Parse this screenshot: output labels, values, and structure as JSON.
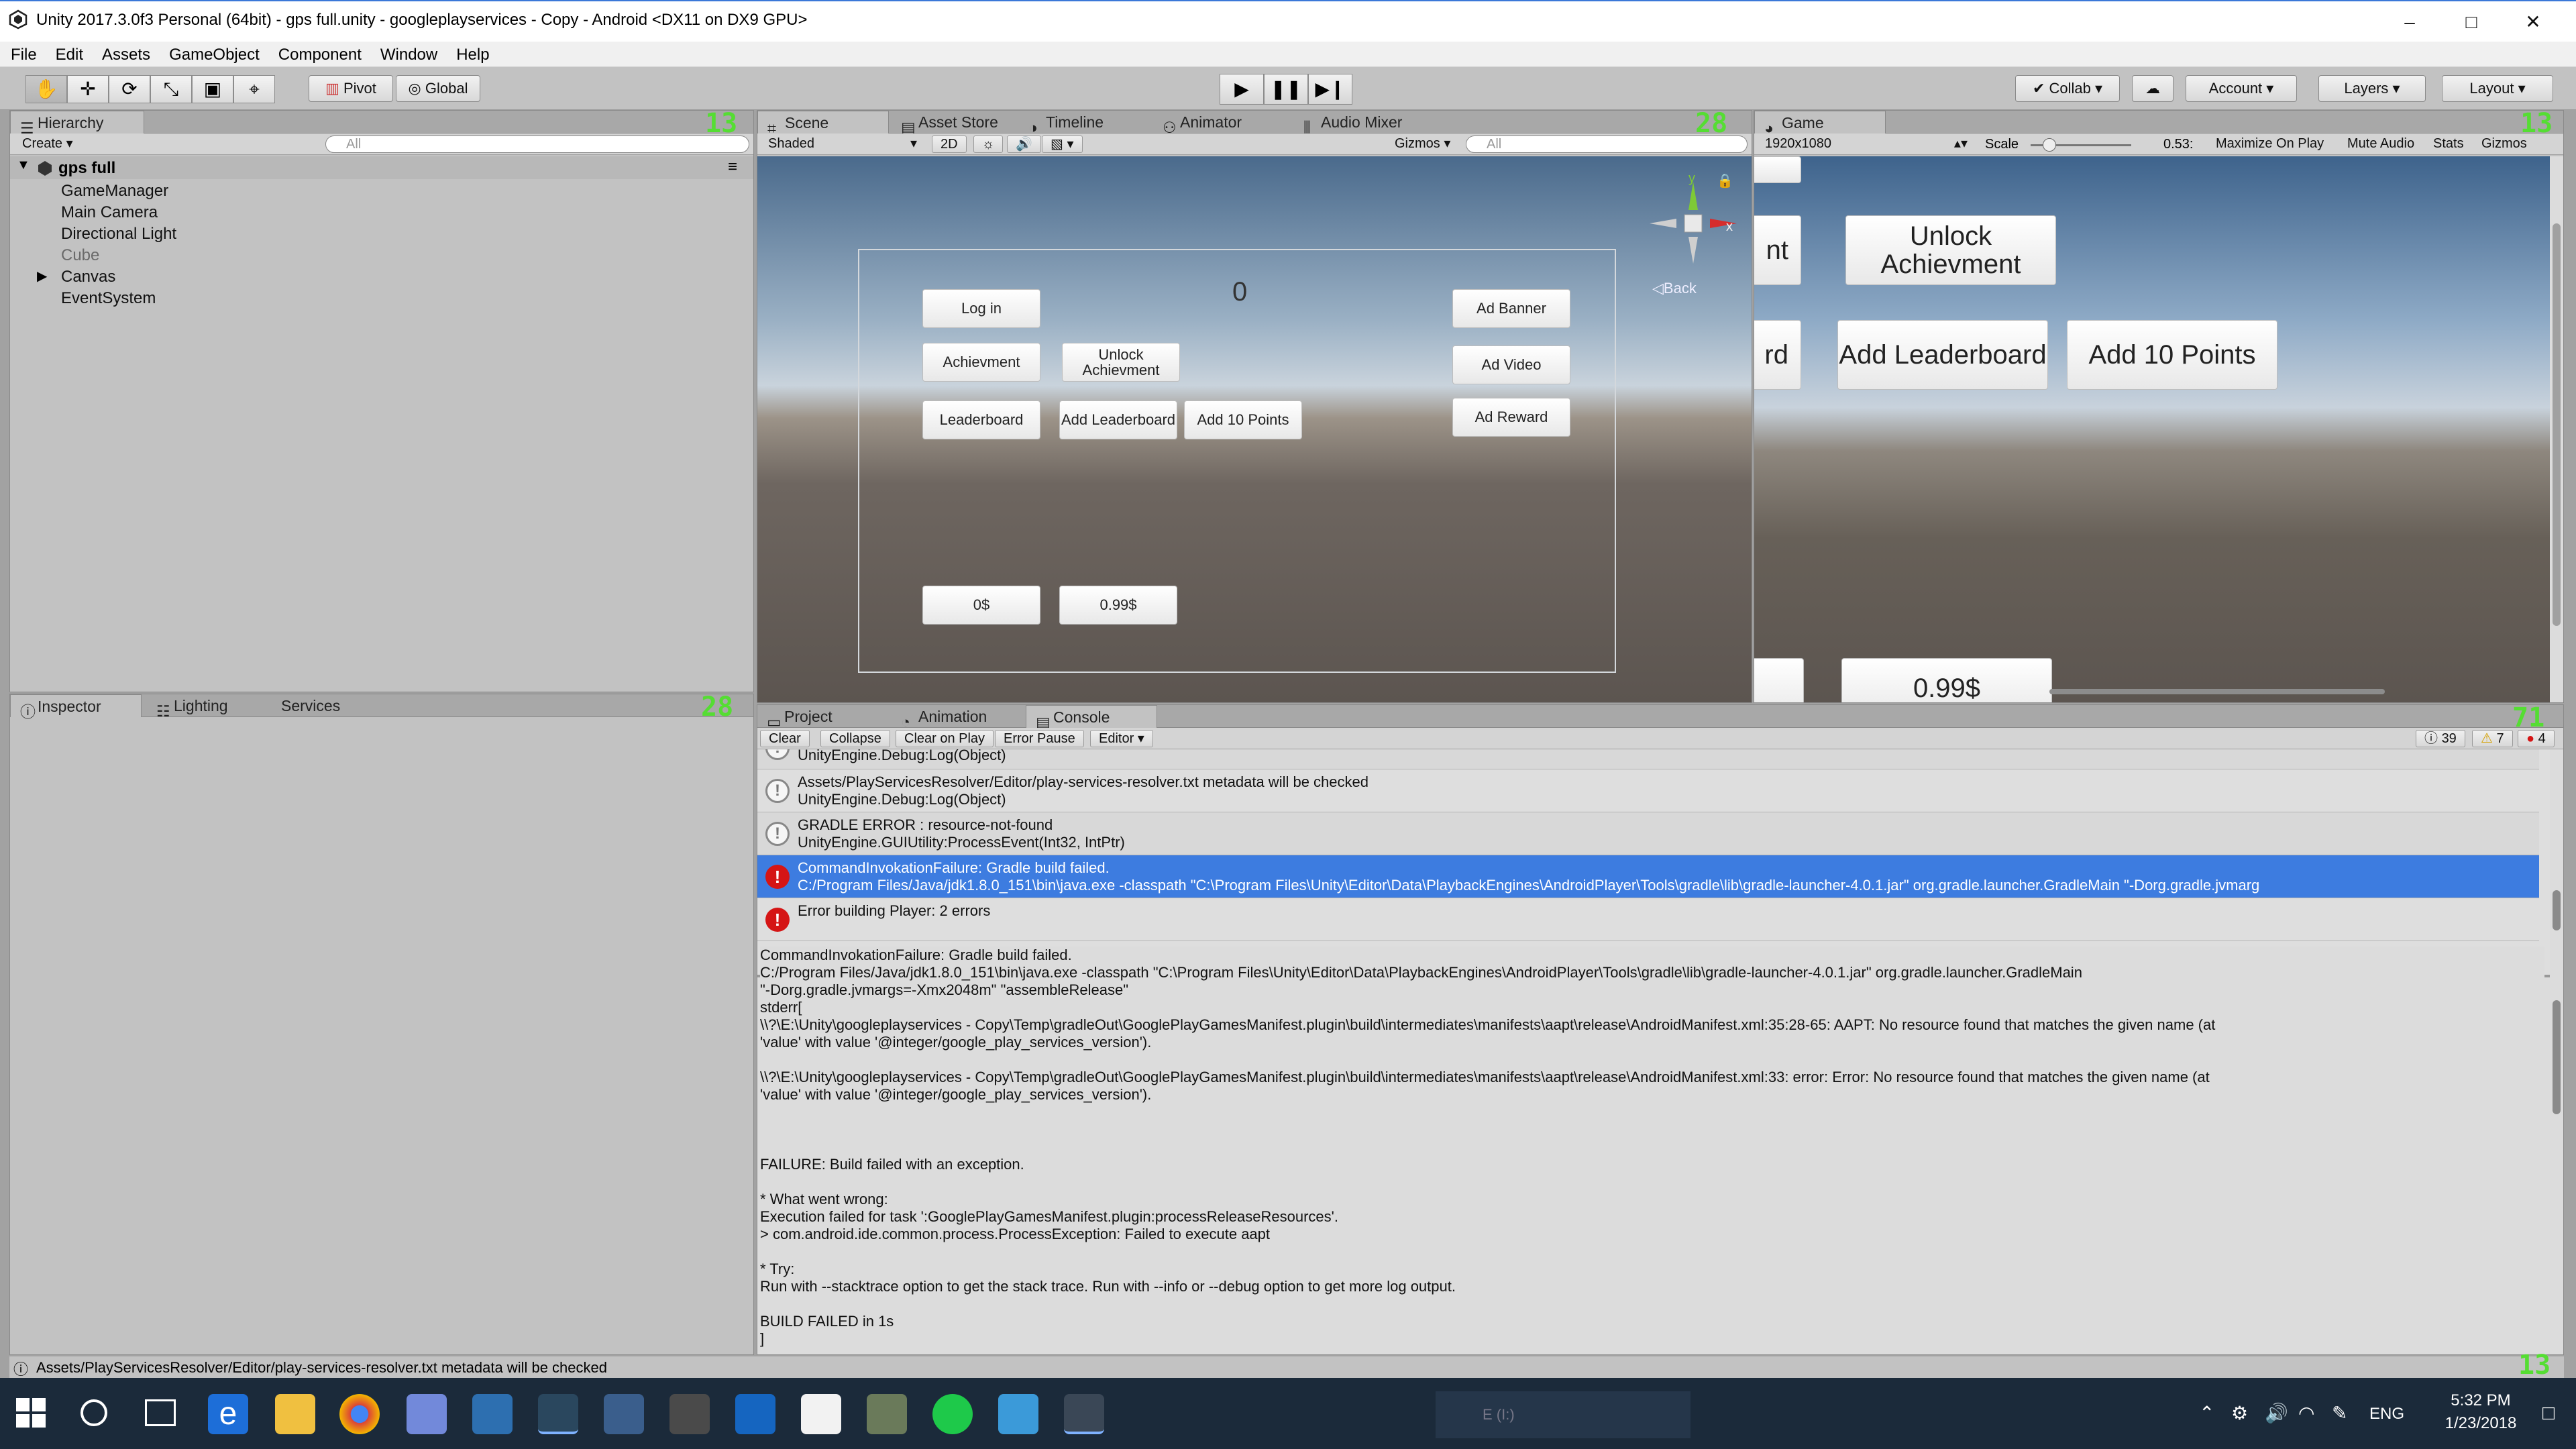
{
  "window": {
    "title": "Unity 2017.3.0f3 Personal (64bit) - gps full.unity - googleplayservices - Copy - Android <DX11 on DX9 GPU>"
  },
  "menu": [
    "File",
    "Edit",
    "Assets",
    "GameObject",
    "Component",
    "Window",
    "Help"
  ],
  "toolbar": {
    "pivot": "Pivot",
    "global": "Global",
    "collab": "Collab",
    "account": "Account",
    "layers": "Layers",
    "layout": "Layout"
  },
  "hierarchy": {
    "tab": "Hierarchy",
    "create": "Create",
    "search_placeholder": "All",
    "scene": "gps full",
    "items": [
      "GameManager",
      "Main Camera",
      "Directional Light",
      "Cube",
      "Canvas",
      "EventSystem"
    ],
    "corner_num": "13"
  },
  "scene": {
    "tabs": [
      "Scene",
      "Asset Store",
      "Timeline",
      "Animator",
      "Audio Mixer"
    ],
    "shading": "Shaded",
    "mode2d": "2D",
    "gizmos": "Gizmos",
    "search_placeholder": "All",
    "gizmo_back": "Back",
    "gizmo_y": "y",
    "gizmo_x": "x",
    "score": "0",
    "buttons": {
      "login": "Log in",
      "achievment": "Achievment",
      "unlock": "Unlock Achievment",
      "leaderboard": "Leaderboard",
      "add_leaderboard": "Add Leaderboard",
      "add10": "Add 10 Points",
      "ad_banner": "Ad Banner",
      "ad_video": "Ad Video",
      "ad_reward": "Ad Reward",
      "price0": "0$",
      "price099": "0.99$"
    },
    "corner_num": "28"
  },
  "game": {
    "tab": "Game",
    "resolution": "1920x1080",
    "scale_label": "Scale",
    "scale_value": "0.53:",
    "maximize": "Maximize On Play",
    "mute": "Mute Audio",
    "stats": "Stats",
    "gizmos": "Gizmos",
    "partial_left1": "nt",
    "partial_left2": "rd",
    "unlock": "Unlock Achievment",
    "add_leaderboard": "Add Leaderboard",
    "add10": "Add 10 Points",
    "price099": "0.99$",
    "corner_num": "13"
  },
  "inspector": {
    "tabs": [
      "Inspector",
      "Lighting",
      "Services"
    ],
    "corner_num": "28"
  },
  "console": {
    "tabs": [
      "Project",
      "Animation",
      "Console"
    ],
    "buttons": [
      "Clear",
      "Collapse",
      "Clear on Play",
      "Error Pause",
      "Editor"
    ],
    "counts": {
      "info": "39",
      "warn": "7",
      "err": "4"
    },
    "corner_num": "71",
    "rows": [
      {
        "type": "warn",
        "line1": "UnityEngine.Debug:Log(Object)",
        "line2": ""
      },
      {
        "type": "warn",
        "line1": "Assets/PlayServicesResolver/Editor/play-services-resolver.txt metadata will be checked",
        "line2": "UnityEngine.Debug:Log(Object)"
      },
      {
        "type": "warn",
        "line1": "GRADLE ERROR : resource-not-found",
        "line2": "UnityEngine.GUIUtility:ProcessEvent(Int32, IntPtr)"
      },
      {
        "type": "err",
        "line1": "CommandInvokationFailure: Gradle build failed.",
        "line2": "C:/Program Files/Java/jdk1.8.0_151\\bin\\java.exe -classpath \"C:\\Program Files\\Unity\\Editor\\Data\\PlaybackEngines\\AndroidPlayer\\Tools\\gradle\\lib\\gradle-launcher-4.0.1.jar\" org.gradle.launcher.GradleMain \"-Dorg.gradle.jvmarg"
      },
      {
        "type": "err",
        "line1": "Error building Player: 2 errors",
        "line2": ""
      }
    ],
    "detail": [
      "CommandInvokationFailure: Gradle build failed.",
      "C:/Program Files/Java/jdk1.8.0_151\\bin\\java.exe -classpath \"C:\\Program Files\\Unity\\Editor\\Data\\PlaybackEngines\\AndroidPlayer\\Tools\\gradle\\lib\\gradle-launcher-4.0.1.jar\" org.gradle.launcher.GradleMain",
      "\"-Dorg.gradle.jvmargs=-Xmx2048m\" \"assembleRelease\"",
      "",
      "stderr[",
      "\\\\?\\E:\\Unity\\googleplayservices - Copy\\Temp\\gradleOut\\GooglePlayGamesManifest.plugin\\build\\intermediates\\manifests\\aapt\\release\\AndroidManifest.xml:35:28-65: AAPT: No resource found that matches the given name (at",
      "'value' with value '@integer/google_play_services_version').",
      "",
      "\\\\?\\E:\\Unity\\googleplayservices - Copy\\Temp\\gradleOut\\GooglePlayGamesManifest.plugin\\build\\intermediates\\manifests\\aapt\\release\\AndroidManifest.xml:33: error: Error: No resource found that matches the given name (at",
      "'value' with value '@integer/google_play_services_version').",
      "",
      "",
      "",
      "FAILURE: Build failed with an exception.",
      "",
      "* What went wrong:",
      "Execution failed for task ':GooglePlayGamesManifest.plugin:processReleaseResources'.",
      "> com.android.ide.common.process.ProcessException: Failed to execute aapt",
      "",
      "* Try:",
      "Run with --stacktrace option to get the stack trace. Run with --info or --debug option to get more log output.",
      "",
      "BUILD FAILED in 1s",
      "]"
    ]
  },
  "status": {
    "message": "Assets/PlayServicesResolver/Editor/play-services-resolver.txt metadata will be checked",
    "corner_num": "13"
  },
  "taskbar": {
    "time": "5:32 PM",
    "date": "1/23/2018",
    "lang": "ENG",
    "drive": "E (I:)"
  }
}
